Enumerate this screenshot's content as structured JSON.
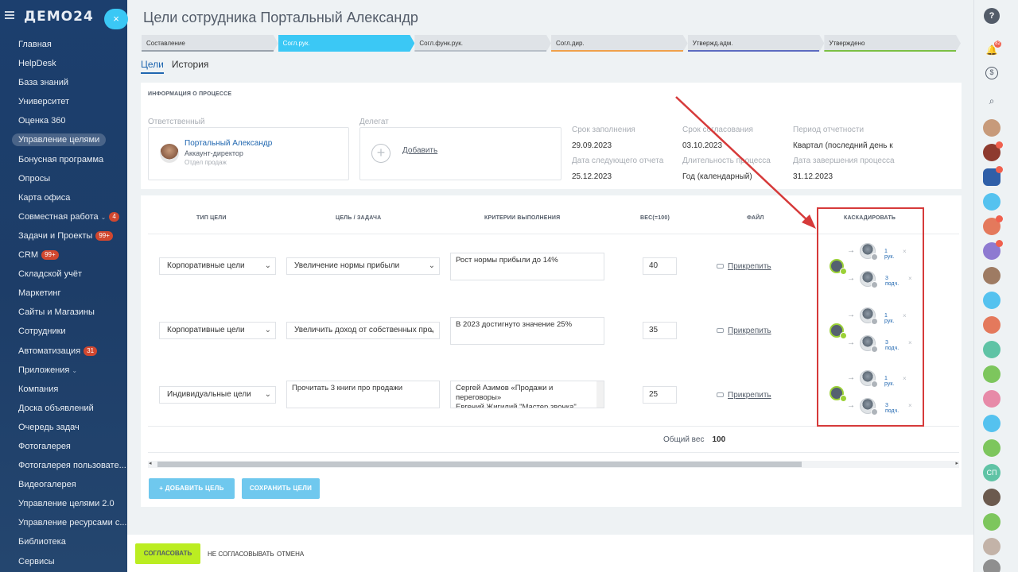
{
  "app": {
    "logo": "ДЕМО24",
    "close": "×"
  },
  "sidebar": {
    "items": [
      {
        "label": "Главная"
      },
      {
        "label": "HelpDesk"
      },
      {
        "label": "База знаний"
      },
      {
        "label": "Университет"
      },
      {
        "label": "Оценка 360"
      },
      {
        "label": "Управление целями"
      },
      {
        "label": "Бонусная программа"
      },
      {
        "label": "Опросы"
      },
      {
        "label": "Карта офиса"
      },
      {
        "label": "Совместная работа",
        "badge": "4"
      },
      {
        "label": "Задачи и Проекты",
        "badge": "99+"
      },
      {
        "label": "CRM",
        "badge": "99+"
      },
      {
        "label": "Складской учёт"
      },
      {
        "label": "Маркетинг"
      },
      {
        "label": "Сайты и Магазины"
      },
      {
        "label": "Сотрудники"
      },
      {
        "label": "Автоматизация",
        "badge": "31"
      },
      {
        "label": "Приложения"
      },
      {
        "label": "Компания"
      },
      {
        "label": "Доска объявлений"
      },
      {
        "label": "Очередь задач"
      },
      {
        "label": "Фотогалерея"
      },
      {
        "label": "Фотогалерея пользовате..."
      },
      {
        "label": "Видеогалерея"
      },
      {
        "label": "Управление целями 2.0"
      },
      {
        "label": "Управление ресурсами с..."
      },
      {
        "label": "Библиотека"
      },
      {
        "label": "Сервисы"
      }
    ]
  },
  "page": {
    "title": "Цели сотрудника Портальный Александр",
    "stages": [
      {
        "label": "Составление",
        "color": "#9aa3ad"
      },
      {
        "label": "Согл.рук.",
        "color": "#3bc8f5"
      },
      {
        "label": "Согл.функ.рук.",
        "color": "#b8c0c8"
      },
      {
        "label": "Согл.дир.",
        "color": "#f0a04b"
      },
      {
        "label": "Утвержд.адм.",
        "color": "#5c6bc0"
      },
      {
        "label": "Утверждено",
        "color": "#7bc043"
      }
    ],
    "tabs": [
      "Цели",
      "История"
    ]
  },
  "info": {
    "header": "ИНФОРМАЦИЯ О ПРОЦЕССЕ",
    "responsible_label": "Ответственный",
    "responsible_name": "Портальный Александр",
    "responsible_position": "Аккаунт-директор",
    "responsible_dept": "Отдел продаж",
    "delegate_label": "Делегат",
    "delegate_add": "Добавить",
    "fill_deadline_label": "Срок заполнения",
    "fill_deadline": "29.09.2023",
    "approval_deadline_label": "Срок согласования",
    "approval_deadline": "03.10.2023",
    "period_label": "Период отчетности",
    "period": "Квартал (последний день к",
    "next_report_label": "Дата следующего отчета",
    "next_report": "25.12.2023",
    "duration_label": "Длительность процесса",
    "duration": "Год (календарный)",
    "end_date_label": "Дата завершения процесса",
    "end_date": "31.12.2023"
  },
  "table": {
    "headers": {
      "type": "ТИП ЦЕЛИ",
      "goal": "ЦЕЛЬ / ЗАДАЧА",
      "criteria": "КРИТЕРИИ ВЫПОЛНЕНИЯ",
      "weight": "ВЕС(=100)",
      "file": "ФАЙЛ",
      "cascade": "КАСКАДИРОВАТЬ"
    },
    "rows": [
      {
        "type": "Корпоративные цели",
        "goal": "Увеличение нормы прибыли",
        "criteria": "Рост нормы прибыли до 14%",
        "weight": "40",
        "attach": "Прикрепить",
        "c1": "1 рук.",
        "c2": "3 подч."
      },
      {
        "type": "Корпоративные цели",
        "goal": "Увеличить доход от собственных про,",
        "criteria": "В 2023 достигнуто значение 25%",
        "weight": "35",
        "attach": "Прикрепить",
        "c1": "1 рук.",
        "c2": "3 подч."
      },
      {
        "type": "Индивидуальные цели",
        "goal": "Прочитать 3 книги про продажи",
        "criteria": "Сергей Азимов «Продажи и переговоры»\nЕвгений Жигилий \"Мастер звонка\"",
        "weight": "25",
        "attach": "Прикрепить",
        "c1": "1 рук.",
        "c2": "3 подч."
      }
    ],
    "total_label": "Общий вес",
    "total": "100"
  },
  "buttons": {
    "add_goal": "+  ДОБАВИТЬ ЦЕЛЬ",
    "save_goals": "СОХРАНИТЬ ЦЕЛИ",
    "approve": "СОГЛАСОВАТЬ",
    "reject": "НЕ СОГЛАСОВЫВАТЬ",
    "cancel": "ОТМЕНА"
  },
  "right_panel": {
    "help": "?",
    "notif_badge": "82",
    "user_initials": "СП"
  },
  "colors": {
    "accent": "#3bc8f5",
    "sidebar": "#1c3f6e",
    "approve": "#bbed21",
    "annotation": "#d63a3a"
  }
}
